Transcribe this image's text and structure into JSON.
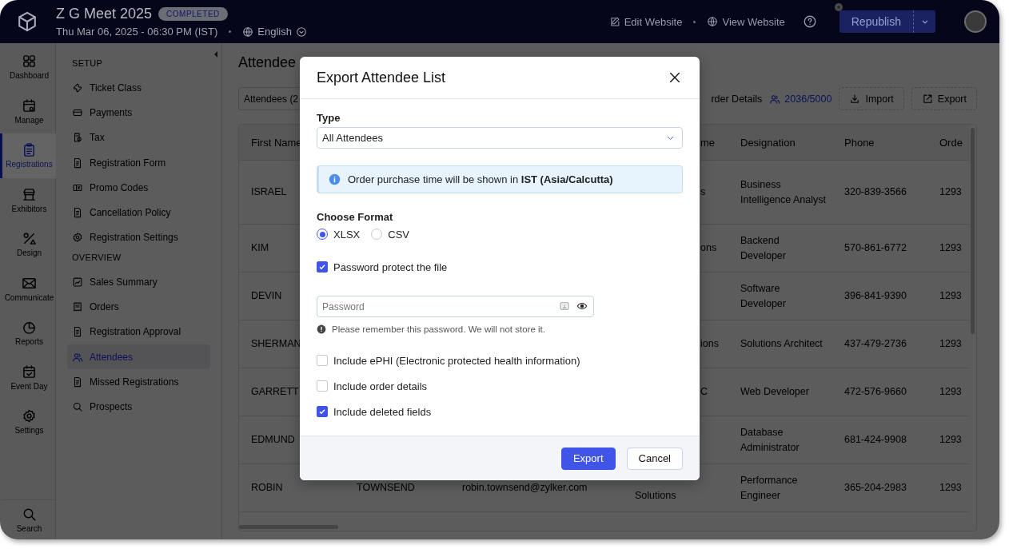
{
  "top_bar": {
    "event_title": "Z G Meet 2025",
    "status_badge": "COMPLETED",
    "event_datetime": "Thu Mar 06, 2025 - 06:30 PM (IST)",
    "language": "English",
    "links": [
      {
        "kind": "edit",
        "label": "Edit Website"
      },
      {
        "kind": "view",
        "label": "View Website"
      }
    ],
    "publish_button": "Republish"
  },
  "nav_rail": {
    "items": [
      {
        "kind": "dashboard",
        "label": "Dashboard",
        "selected": false
      },
      {
        "kind": "manage",
        "label": "Manage",
        "selected": false
      },
      {
        "kind": "registrations",
        "label": "Registrations",
        "selected": true
      },
      {
        "kind": "exhibitors",
        "label": "Exhibitors",
        "selected": false
      },
      {
        "kind": "design",
        "label": "Design",
        "selected": false
      },
      {
        "kind": "communicate",
        "label": "Communicate",
        "selected": false
      },
      {
        "kind": "reports",
        "label": "Reports",
        "selected": false
      },
      {
        "kind": "eventday",
        "label": "Event Day",
        "selected": false
      },
      {
        "kind": "settings",
        "label": "Settings",
        "selected": false
      }
    ],
    "search": "Search"
  },
  "sidebar": {
    "sections": [
      {
        "heading": "SETUP",
        "items": [
          {
            "kind": "ticket",
            "label": "Ticket Class",
            "selected": false
          },
          {
            "kind": "card",
            "label": "Payments",
            "selected": false
          },
          {
            "kind": "tax",
            "label": "Tax",
            "selected": false
          },
          {
            "kind": "doc",
            "label": "Registration Form",
            "selected": false
          },
          {
            "kind": "promo",
            "label": "Promo Codes",
            "selected": false
          },
          {
            "kind": "doc",
            "label": "Cancellation Policy",
            "selected": false
          },
          {
            "kind": "gear",
            "label": "Registration Settings",
            "selected": false
          }
        ]
      },
      {
        "heading": "OVERVIEW",
        "items": [
          {
            "kind": "chart",
            "label": "Sales Summary",
            "selected": false
          },
          {
            "kind": "receipt",
            "label": "Orders",
            "selected": false
          },
          {
            "kind": "doc",
            "label": "Registration Approval",
            "selected": false
          },
          {
            "kind": "people",
            "label": "Attendees",
            "selected": true
          },
          {
            "kind": "doc",
            "label": "Missed Registrations",
            "selected": false
          },
          {
            "kind": "search",
            "label": "Prospects",
            "selected": false
          }
        ]
      }
    ]
  },
  "page": {
    "title": "Attendee",
    "filter": "Attendees (2",
    "order_details": "rder Details",
    "attendee_count": "2036/5000",
    "import_button": "Import",
    "export_button": "Export"
  },
  "table": {
    "columns": {
      "first_name": "First Name",
      "column_4": "me",
      "designation": "Designation",
      "phone": "Phone",
      "column_7": "Orde"
    },
    "rows": [
      {
        "first_name": "ISRAEL",
        "column_4": "s",
        "designation": "Business Intelligence Analyst",
        "phone": "320-839-3566",
        "column_7": "1293"
      },
      {
        "first_name": "KIM",
        "column_4": "ons",
        "designation": "Backend Developer",
        "phone": "570-861-6772",
        "column_7": "1293"
      },
      {
        "first_name": "DEVIN",
        "designation": "Software Developer",
        "phone": "396-841-9390",
        "column_7": "1293"
      },
      {
        "first_name": "SHERMAN",
        "column_4": "ions",
        "designation": "Solutions Architect",
        "phone": "437-479-2736",
        "column_7": "1293"
      },
      {
        "first_name": "GARRETT",
        "column_4": "C",
        "designation": "Web Developer",
        "phone": "472-576-9660",
        "column_7": "1293"
      },
      {
        "first_name": "EDMUND",
        "designation": "Database Administrator",
        "phone": "681-424-9908",
        "column_7": "1293"
      },
      {
        "first_name": "ROBIN",
        "last_name": "TOWNSEND",
        "email": "robin.townsend@zylker.com",
        "column_4_below": "Solutions",
        "designation": "Performance Engineer",
        "phone": "365-204-2983",
        "column_7": "1293"
      }
    ]
  },
  "dialog": {
    "title": "Export Attendee List",
    "type_label": "Type",
    "type_value": "All Attendees",
    "info": "Order purchase time will be shown in **IST (Asia/Calcutta)**",
    "format_label": "Choose Format",
    "formats": [
      {
        "label": "XLSX",
        "selected": true
      },
      {
        "label": "CSV",
        "selected": false
      }
    ],
    "password_protect": {
      "label": "Password protect the file",
      "checked": true
    },
    "password": {
      "placeholder": "Password"
    },
    "password_hint": "Please remember this password. We will not store it.",
    "options": [
      {
        "label": "Include ePHI (Electronic protected health information)",
        "checked": false
      },
      {
        "label": "Include order details",
        "checked": false
      },
      {
        "label": "Include deleted fields",
        "checked": true
      }
    ],
    "buttons": [
      {
        "kind": "primary",
        "label": "Export"
      },
      {
        "kind": "secondary",
        "label": "Cancel"
      }
    ]
  }
}
